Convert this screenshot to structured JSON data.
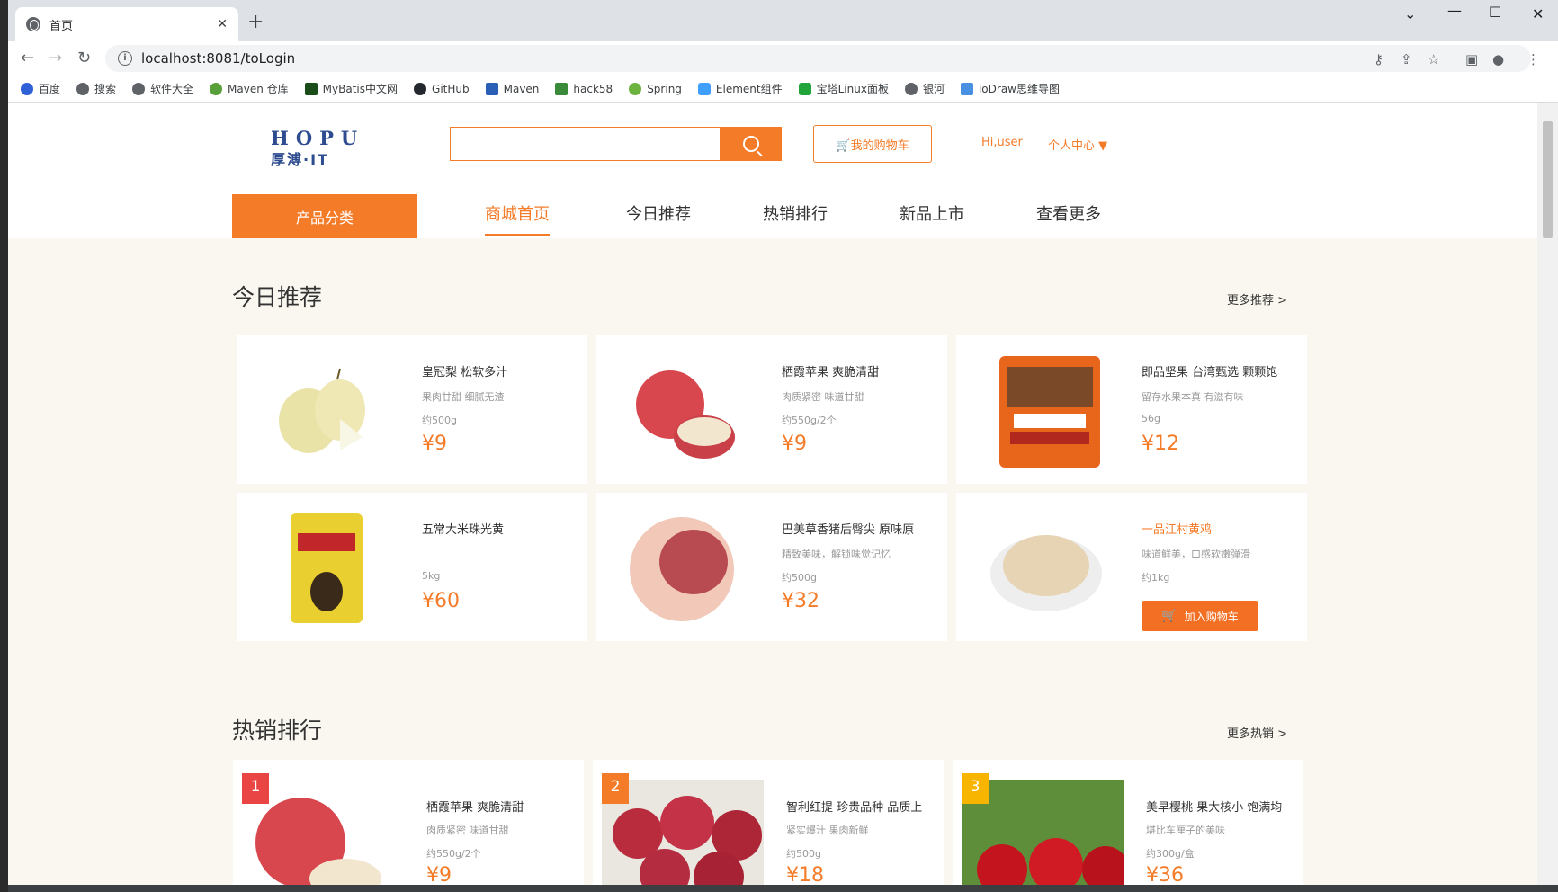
{
  "browser": {
    "tab_title": "首页",
    "url": "localhost:8081/toLogin",
    "bookmarks": [
      "百度",
      "搜索",
      "软件大全",
      "Maven 仓库",
      "MyBatis中文网",
      "GitHub",
      "Maven",
      "hack58",
      "Spring",
      "Element组件",
      "宝塔Linux面板",
      "银河",
      "ioDraw思维导图"
    ]
  },
  "header": {
    "logo_en": "HOPU",
    "logo_cn": "厚溥·IT",
    "search_placeholder": "",
    "cart_label": "🛒我的购物车",
    "greeting": "Hi,user",
    "user_center": "个人中心 ▼"
  },
  "nav": {
    "category_button": "产品分类",
    "links": [
      "商城首页",
      "今日推荐",
      "热销排行",
      "新品上市",
      "查看更多"
    ]
  },
  "today": {
    "title": "今日推荐",
    "more": "更多推荐 >",
    "items": [
      {
        "name": "皇冠梨 松软多汁",
        "desc": "果肉甘甜 细腻无渣",
        "weight": "约500g",
        "price": "¥9"
      },
      {
        "name": "栖霞苹果 爽脆清甜",
        "desc": "肉质紧密 味道甘甜",
        "weight": "约550g/2个",
        "price": "¥9"
      },
      {
        "name": "即品坚果 台湾甄选 颗颗饱",
        "desc": "留存水果本真 有滋有味",
        "weight": "56g",
        "price": "¥12"
      },
      {
        "name": "五常大米珠光黄",
        "desc": "",
        "weight": "5kg",
        "price": "¥60"
      },
      {
        "name": "巴美草香猪后臀尖 原味原",
        "desc": "精致美味，解锁味觉记忆",
        "weight": "约500g",
        "price": "¥32"
      },
      {
        "name": "一品江村黄鸡",
        "desc": "味道鲜美，口感软嫩弹滑",
        "weight": "约1kg",
        "price": "",
        "add_cart": "加入购物车"
      }
    ]
  },
  "hot": {
    "title": "热销排行",
    "more": "更多热销 >",
    "items": [
      {
        "rank": "1",
        "name": "栖霞苹果 爽脆清甜",
        "desc": "肉质紧密 味道甘甜",
        "weight": "约550g/2个",
        "price": "¥9"
      },
      {
        "rank": "2",
        "name": "智利红提 珍贵品种 品质上",
        "desc": "紧实爆汁 果肉新鲜",
        "weight": "约500g",
        "price": "¥18"
      },
      {
        "rank": "3",
        "name": "美早樱桃 果大核小 饱满均",
        "desc": "堪比车厘子的美味",
        "weight": "约300g/盒",
        "price": "¥36"
      }
    ]
  },
  "colors": {
    "accent": "#f47b28",
    "rank1": "#e94545",
    "rank2": "#f47b28",
    "rank3": "#f7b500"
  }
}
